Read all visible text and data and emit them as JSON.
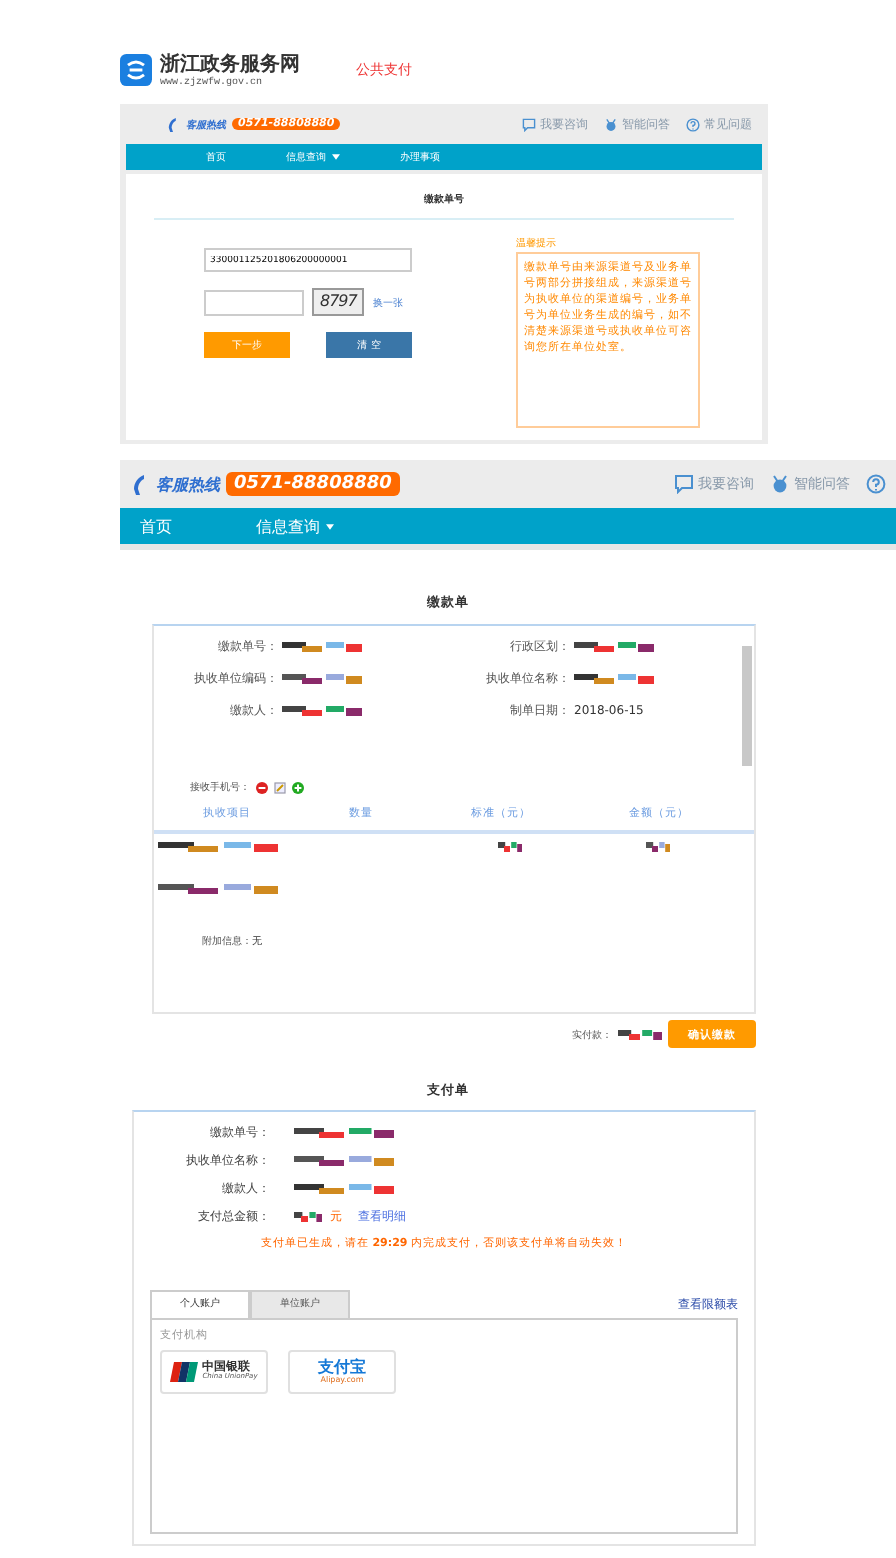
{
  "site_header": {
    "name": "浙江政务服务网",
    "url": "www.zjzwfw.gov.cn",
    "section": "公共支付"
  },
  "query_screen": {
    "hotline_label": "客服热线",
    "hotline": "0571-88808880",
    "links": [
      "我要咨询",
      "智能问答",
      "常见问题"
    ],
    "nav": [
      {
        "label": "首页",
        "dropdown": false
      },
      {
        "label": "信息查询",
        "dropdown": true
      },
      {
        "label": "办理事项",
        "dropdown": false
      }
    ],
    "form_title": "缴款单号",
    "code_value": "330001125201806200000001",
    "captcha": "8797",
    "refresh_link": "换一张",
    "buttons": [
      {
        "label": "下一步",
        "kind": "primary"
      },
      {
        "label": "清 空",
        "kind": "secondary"
      }
    ],
    "tip_title": "温馨提示",
    "tip_text": "缴款单号由来源渠道号及业务单号两部分拼接组成，来源渠道号为执收单位的渠道编号，业务单号为单位业务生成的编号，如不清楚来源渠道号或执收单位可咨询您所在单位处室。"
  },
  "result_screen": {
    "hotline_label": "客服热线",
    "hotline": "0571-88808880",
    "links": [
      "我要咨询",
      "智能问答"
    ],
    "nav": [
      {
        "label": "首页",
        "dropdown": false
      },
      {
        "label": "信息查询",
        "dropdown": true
      }
    ]
  },
  "bill": {
    "title": "缴款单",
    "fields": [
      {
        "label": "缴款单号：",
        "kind": "redacted"
      },
      {
        "label": "行政区划：",
        "kind": "redacted"
      },
      {
        "label": "执收单位编码：",
        "kind": "redacted"
      },
      {
        "label": "执收单位名称：",
        "kind": "redacted"
      },
      {
        "label": "缴款人：",
        "kind": "redacted"
      },
      {
        "label": "制单日期：",
        "kind": "text",
        "value": "2018-06-15"
      }
    ],
    "phone_label": "接收手机号：",
    "columns": [
      "执收项目",
      "数量",
      "标准（元）",
      "金额（元）"
    ],
    "extra_label": "附加信息：",
    "extra_value": "无",
    "paid_label": "实付款：",
    "confirm_button": "确认缴款"
  },
  "pay_order": {
    "title": "支付单",
    "fields": [
      {
        "label": "缴款单号：",
        "kind": "redacted"
      },
      {
        "label": "执收单位名称：",
        "kind": "redacted"
      },
      {
        "label": "缴款人：",
        "kind": "redacted"
      }
    ],
    "total_label": "支付总金额：",
    "total_unit": "元",
    "detail_link": "查看明细",
    "notice": "支付单已生成，请在 **29:29** 内完成支付，否则该支付单将自动失效！",
    "tabs": [
      {
        "label": "个人账户",
        "selected": true
      },
      {
        "label": "单位账户",
        "selected": false
      }
    ],
    "limit_link": "查看限额表",
    "institutions_label": "支付机构",
    "institutions": [
      {
        "kind": "unionpay",
        "name": "中国银联",
        "subname": "China UnionPay"
      },
      {
        "kind": "alipay",
        "name": "支付宝",
        "subname": "Alipay.com"
      }
    ]
  }
}
